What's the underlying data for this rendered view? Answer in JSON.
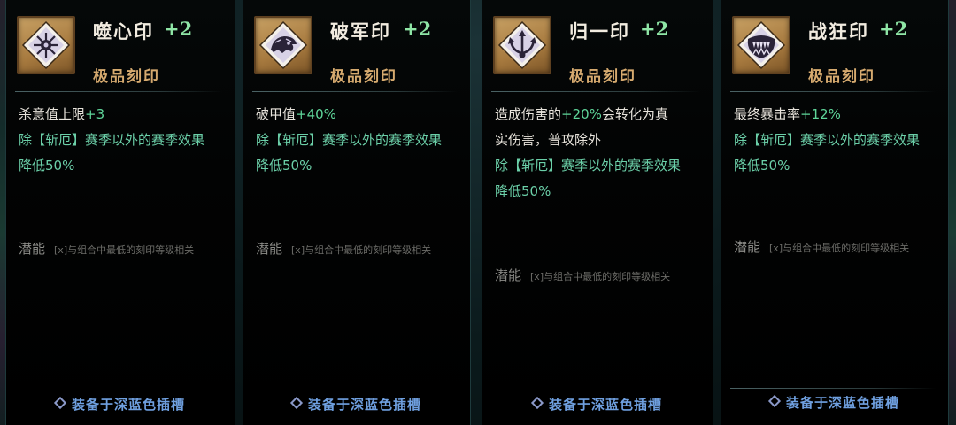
{
  "cards": [
    {
      "name": "噬心印",
      "level": "+2",
      "quality": "极品刻印",
      "emblem_icon": "burst-heart-icon",
      "effects": [
        {
          "segments": [
            {
              "text": "杀意值上限",
              "color": "white"
            },
            {
              "text": "+3",
              "color": "green"
            }
          ]
        },
        {
          "segments": [
            {
              "text": "除【斩厄】赛季以外的赛季效果",
              "color": "teal"
            }
          ]
        },
        {
          "segments": [
            {
              "text": "降低50%",
              "color": "teal"
            }
          ]
        }
      ],
      "potential_label": "潜能",
      "potential_desc": "[x]与组合中最低的刻印等级相关",
      "footer": "装备于深蓝色插槽"
    },
    {
      "name": "破军印",
      "level": "+2",
      "quality": "极品刻印",
      "emblem_icon": "dragon-helm-icon",
      "effects": [
        {
          "segments": [
            {
              "text": "破甲值",
              "color": "white"
            },
            {
              "text": "+40%",
              "color": "green"
            }
          ]
        },
        {
          "segments": [
            {
              "text": "除【斩厄】赛季以外的赛季效果",
              "color": "teal"
            }
          ]
        },
        {
          "segments": [
            {
              "text": "降低50%",
              "color": "teal"
            }
          ]
        }
      ],
      "potential_label": "潜能",
      "potential_desc": "[x]与组合中最低的刻印等级相关",
      "footer": "装备于深蓝色插槽"
    },
    {
      "name": "归一印",
      "level": "+2",
      "quality": "极品刻印",
      "emblem_icon": "converging-arrows-icon",
      "effects": [
        {
          "segments": [
            {
              "text": "造成伤害的",
              "color": "white"
            },
            {
              "text": "+20%",
              "color": "green"
            },
            {
              "text": "会转化为真",
              "color": "white"
            }
          ]
        },
        {
          "segments": [
            {
              "text": "实伤害，普攻除外",
              "color": "white"
            }
          ]
        },
        {
          "segments": [
            {
              "text": "除【斩厄】赛季以外的赛季效果",
              "color": "teal"
            }
          ]
        },
        {
          "segments": [
            {
              "text": "降低50%",
              "color": "teal"
            }
          ]
        }
      ],
      "potential_label": "潜能",
      "potential_desc": "[x]与组合中最低的刻印等级相关",
      "footer": "装备于深蓝色插槽"
    },
    {
      "name": "战狂印",
      "level": "+2",
      "quality": "极品刻印",
      "emblem_icon": "fanged-maw-icon",
      "effects": [
        {
          "segments": [
            {
              "text": "最终暴击率",
              "color": "white"
            },
            {
              "text": "+12%",
              "color": "green"
            }
          ]
        },
        {
          "segments": [
            {
              "text": "除【斩厄】赛季以外的赛季效果",
              "color": "teal"
            }
          ]
        },
        {
          "segments": [
            {
              "text": "降低50%",
              "color": "teal"
            }
          ]
        }
      ],
      "potential_label": "潜能",
      "potential_desc": "[x]与组合中最低的刻印等级相关",
      "footer": "装备于深蓝色插槽"
    }
  ]
}
